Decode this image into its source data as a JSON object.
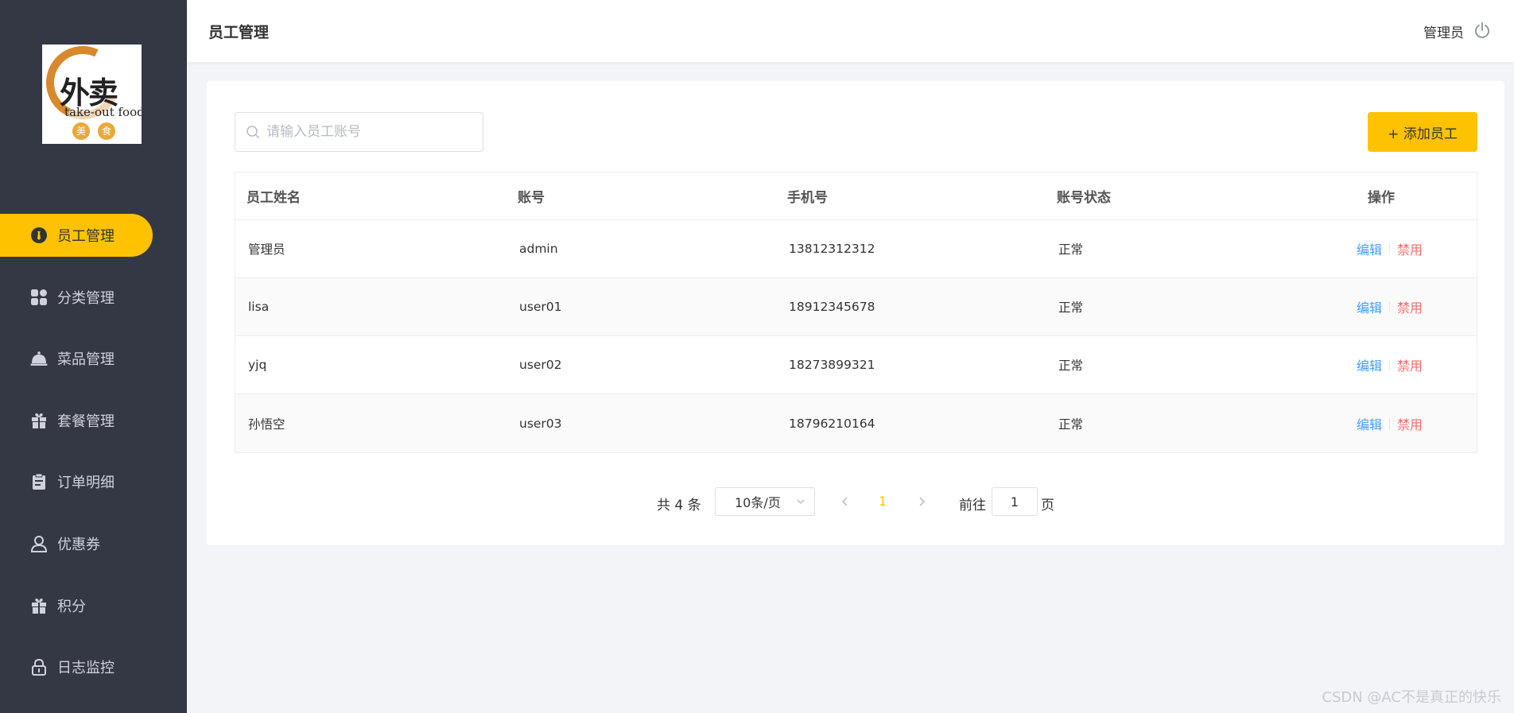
{
  "sidebar": {
    "logo": {
      "cn": "外卖",
      "en": "take-out food",
      "badge1": "美",
      "badge2": "食"
    },
    "items": [
      {
        "label": "员工管理",
        "icon": "employee-icon",
        "active": true
      },
      {
        "label": "分类管理",
        "icon": "category-grid-icon",
        "active": false
      },
      {
        "label": "菜品管理",
        "icon": "dish-cloche-icon",
        "active": false
      },
      {
        "label": "套餐管理",
        "icon": "gift-box-icon",
        "active": false
      },
      {
        "label": "订单明细",
        "icon": "clipboard-icon",
        "active": false
      },
      {
        "label": "优惠券",
        "icon": "user-icon",
        "active": false
      },
      {
        "label": "积分",
        "icon": "gift-icon",
        "active": false
      },
      {
        "label": "日志监控",
        "icon": "lock-icon",
        "active": false
      }
    ]
  },
  "header": {
    "title": "员工管理",
    "user": "管理员",
    "power_icon": "power-icon"
  },
  "toolbar": {
    "search_placeholder": "请输入员工账号",
    "add_label": "+ 添加员工"
  },
  "table": {
    "columns": [
      "员工姓名",
      "账号",
      "手机号",
      "账号状态",
      "操作"
    ],
    "rows": [
      {
        "name": "管理员",
        "account": "admin",
        "phone": "13812312312",
        "status": "正常"
      },
      {
        "name": "lisa",
        "account": "user01",
        "phone": "18912345678",
        "status": "正常"
      },
      {
        "name": "yjq",
        "account": "user02",
        "phone": "18273899321",
        "status": "正常"
      },
      {
        "name": "孙悟空",
        "account": "user03",
        "phone": "18796210164",
        "status": "正常"
      }
    ],
    "edit_label": "编辑",
    "disable_label": "禁用"
  },
  "pagination": {
    "total_text": "共 4 条",
    "page_size": "10条/页",
    "current_page": "1",
    "goto_label": "前往",
    "goto_value": "1",
    "goto_suffix": "页"
  },
  "watermark": "CSDN @AC不是真正的快乐",
  "colors": {
    "sidebar_bg": "#343744",
    "accent": "#ffc200",
    "link": "#419eff",
    "danger": "#f56c6c"
  }
}
